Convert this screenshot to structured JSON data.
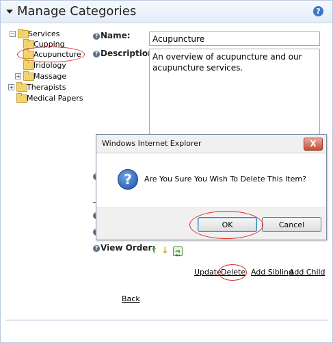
{
  "header": {
    "title": "Manage Categories",
    "help": "?"
  },
  "tree": {
    "items": [
      {
        "label": "Services",
        "expander": "−"
      },
      {
        "label": "Cupping"
      },
      {
        "label": "Acupuncture"
      },
      {
        "label": "Iridology"
      },
      {
        "label": "Massage",
        "expander": "+"
      },
      {
        "label": "Therapists",
        "expander": "+"
      },
      {
        "label": "Medical Papers"
      }
    ]
  },
  "form": {
    "name_label": "Name:",
    "name_value": "Acupuncture",
    "description_label": "Description:",
    "description_value": "An overview of acupuncture and our acupuncture services.",
    "view_order_label": "View Order:",
    "view_order_up": "↑",
    "view_order_down": "↓"
  },
  "actions": {
    "update": "Update",
    "delete": "Delete",
    "add_sibling": "Add Sibling",
    "add_child": "Add Child",
    "back": "Back"
  },
  "dialog": {
    "title": "Windows Internet Explorer",
    "close": "X",
    "icon": "?",
    "message": "Are You Sure You Wish To Delete This Item?",
    "ok": "OK",
    "cancel": "Cancel"
  },
  "colors": {
    "highlight_ring": "#d9302a",
    "up_arrow": "#3aa02f",
    "down_arrow": "#e0a020"
  }
}
